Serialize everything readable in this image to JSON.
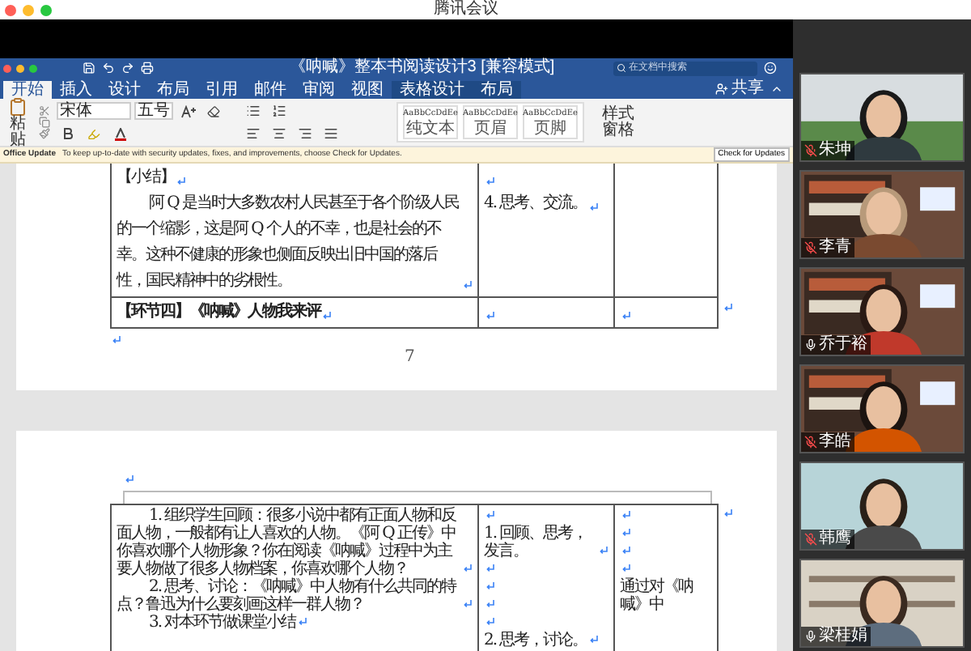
{
  "app_title": "腾讯会议",
  "word": {
    "title": "《呐喊》整本书阅读设计3 [兼容模式]",
    "search": {
      "placeholder": "在文档中搜索"
    },
    "tabs": [
      {
        "label": "开始",
        "selected": true,
        "kind": "main"
      },
      {
        "label": "插入",
        "selected": false,
        "kind": "main"
      },
      {
        "label": "设计",
        "selected": false,
        "kind": "main"
      },
      {
        "label": "布局",
        "selected": false,
        "kind": "main"
      },
      {
        "label": "引用",
        "selected": false,
        "kind": "main"
      },
      {
        "label": "邮件",
        "selected": false,
        "kind": "main"
      },
      {
        "label": "审阅",
        "selected": false,
        "kind": "main"
      },
      {
        "label": "视图",
        "selected": false,
        "kind": "main"
      },
      {
        "label": "表格设计",
        "selected": false,
        "kind": "table"
      },
      {
        "label": "布局",
        "selected": false,
        "kind": "table"
      }
    ],
    "share": "共享",
    "ribbon": {
      "paste": "粘贴",
      "font": "宋体",
      "size": "五号",
      "styles": [
        {
          "preview": "AaBbCcDdEe",
          "name": "纯文本"
        },
        {
          "preview": "AaBbCcDdEe",
          "name": "页眉"
        },
        {
          "preview": "AaBbCcDdEe",
          "name": "页脚"
        }
      ],
      "styles_pane": "样式窗格"
    },
    "update_bar": {
      "title": "Office Update",
      "message": "To keep up-to-date with security updates, fixes, and improvements, choose Check for Updates.",
      "button": "Check for Updates"
    },
    "pages": [
      {
        "rows": [
          {
            "cells": [
              {
                "paragraphs": [
                  {
                    "text": "【小结】",
                    "mark": true
                  },
                  {
                    "text": "阿 Q 是当时大多数农村人民甚至于各个阶级人民的一个缩影，这是阿 Q 个人的不幸，也是社会的不幸。这种不健康的形象也侧面反映出旧中国的落后性，国民精神中的劣根性。",
                    "mark": true,
                    "indent": true
                  }
                ]
              },
              {
                "paragraphs": [
                  {
                    "mark": true
                  },
                  {
                    "text": "4. 思考、交流。",
                    "mark": true
                  }
                ]
              },
              {}
            ],
            "row_mark": false
          },
          {
            "cells": [
              {
                "paragraphs": [
                  {
                    "text": "【环节四】《呐喊》人物我来评",
                    "mark": true,
                    "bold": true
                  }
                ]
              },
              {
                "paragraphs": [
                  {
                    "mark": true
                  }
                ]
              },
              {
                "paragraphs": [
                  {
                    "mark": true
                  }
                ]
              }
            ],
            "row_mark": true
          }
        ],
        "page_number": "7"
      },
      {
        "rows": [
          {
            "cells": [
              {
                "paragraphs": [
                  {
                    "text": "1. 组织学生回顾：很多小说中都有正面人物和反面人物，一般都有让人喜欢的人物。《阿 Q 正传》中你喜欢哪个人物形象？你在阅读《呐喊》过程中为主要人物做了很多人物档案，你喜欢哪个人物？",
                    "mark": true,
                    "indent": true
                  },
                  {
                    "text": "2. 思考、讨论：《呐喊》中人物有什么共同的特点？鲁迅为什么要刻画这样一群人物？",
                    "mark": true,
                    "indent": true
                  },
                  {
                    "text": "3. 对本环节做课堂小结",
                    "mark": true,
                    "indent": true
                  }
                ]
              },
              {
                "paragraphs": [
                  {
                    "mark": true
                  },
                  {
                    "text": "1. 回顾、思考，发言。",
                    "mark": true
                  },
                  {
                    "mark": true
                  },
                  {
                    "mark": true
                  },
                  {
                    "mark": true
                  },
                  {
                    "mark": true
                  },
                  {
                    "text": "2. 思考，讨论。",
                    "mark": true
                  }
                ]
              },
              {
                "paragraphs": [
                  {
                    "mark": true
                  },
                  {
                    "mark": true
                  },
                  {
                    "mark": true
                  },
                  {
                    "mark": true
                  },
                  {
                    "text": "通过对《呐喊》中"
                  }
                ]
              }
            ],
            "row_mark": true
          }
        ]
      }
    ]
  },
  "participants": [
    {
      "name": "朱坤",
      "muted": true
    },
    {
      "name": "李青",
      "muted": true
    },
    {
      "name": "乔于裕",
      "muted": false
    },
    {
      "name": "李皓",
      "muted": true
    },
    {
      "name": "韩鹰",
      "muted": true
    },
    {
      "name": "梁桂娟",
      "muted": false
    }
  ]
}
